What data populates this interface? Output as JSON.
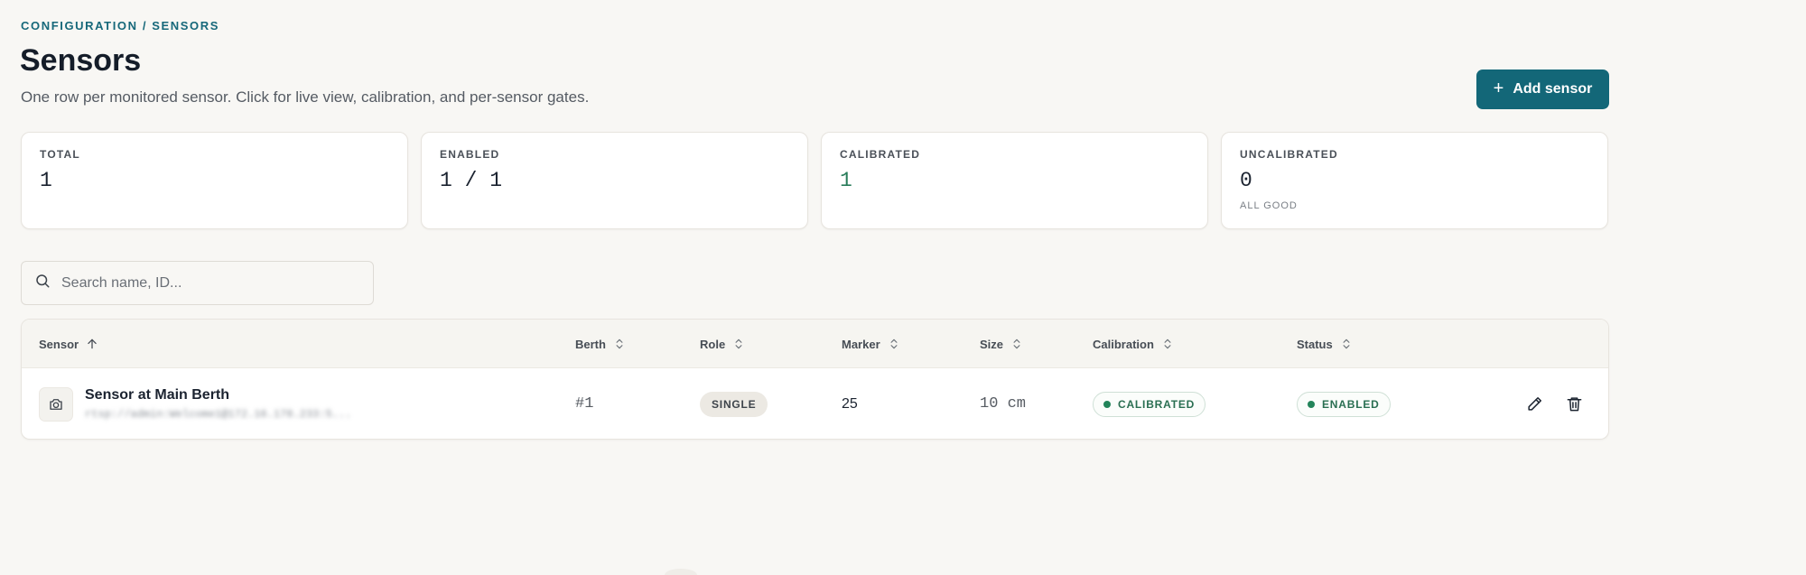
{
  "breadcrumb": "CONFIGURATION / SENSORS",
  "header": {
    "title": "Sensors",
    "subtitle": "One row per monitored sensor. Click for live view, calibration, and per-sensor gates.",
    "add_button_label": "Add sensor"
  },
  "stats": [
    {
      "label": "TOTAL",
      "value": "1",
      "sub": ""
    },
    {
      "label": "ENABLED",
      "value": "1 / 1",
      "sub": ""
    },
    {
      "label": "CALIBRATED",
      "value": "1",
      "sub": ""
    },
    {
      "label": "UNCALIBRATED",
      "value": "0",
      "sub": "ALL GOOD"
    }
  ],
  "search": {
    "placeholder": "Search name, ID..."
  },
  "table": {
    "columns": [
      "Sensor",
      "Berth",
      "Role",
      "Marker",
      "Size",
      "Calibration",
      "Status"
    ],
    "rows": [
      {
        "name": "Sensor at Main Berth",
        "url": "rtsp://admin:Welcome1@172.16.178.233:5...",
        "berth": "#1",
        "role": "SINGLE",
        "marker": "25",
        "size": "10 cm",
        "calibration": "CALIBRATED",
        "status": "ENABLED"
      }
    ]
  },
  "colors": {
    "accent": "#136778",
    "success": "#23845a",
    "background": "#f8f7f4"
  },
  "icons": {
    "add": "plus-icon",
    "search": "search-icon",
    "sort_active": "arrow-up-icon",
    "sort": "chevron-up-down-icon",
    "sensor": "camera-icon",
    "edit": "pencil-icon",
    "delete": "trash-icon"
  }
}
